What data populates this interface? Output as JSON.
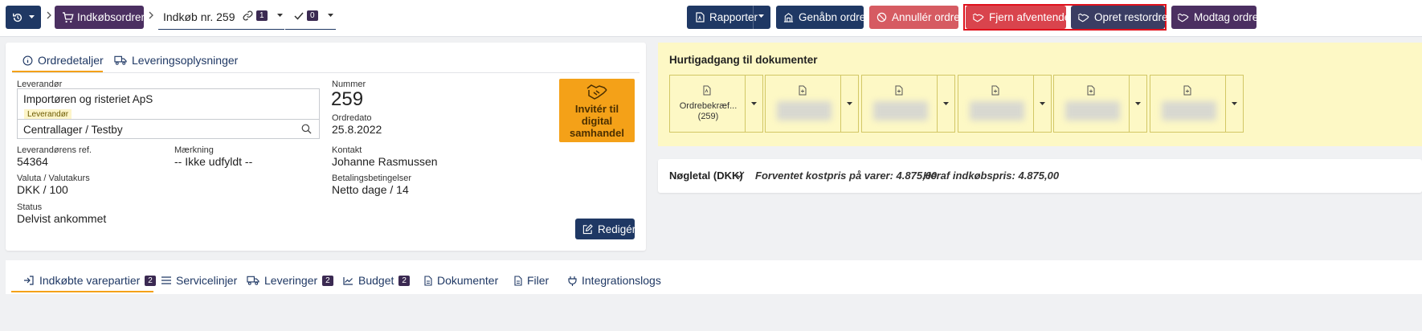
{
  "topbar": {
    "breadcrumb": "Indkøbsordrer",
    "order_title": "Indkøb nr. 259",
    "links_count": "1",
    "checks_count": "0",
    "reports": "Rapporter",
    "reopen": "Genåbn ordre",
    "cancel": "Annullér ordre",
    "remove_pending": "Fjern afventende",
    "create_backorder": "Opret restordre",
    "receive": "Modtag ordre"
  },
  "details": {
    "tab_order": "Ordredetaljer",
    "tab_delivery": "Leveringsoplysninger",
    "supplier_label": "Leverandør",
    "supplier_name": "Importøren og risteriet ApS",
    "supplier_tag": "Leverandør",
    "warehouse": "Centrallager / Testby",
    "supplier_ref_label": "Leverandørens ref.",
    "supplier_ref": "54364",
    "marking_label": "Mærkning",
    "marking": "-- Ikke udfyldt --",
    "currency_label": "Valuta / Valutakurs",
    "currency": "DKK / 100",
    "status_label": "Status",
    "status": "Delvist ankommet",
    "number_label": "Nummer",
    "number": "259",
    "order_date_label": "Ordredato",
    "order_date": "25.8.2022",
    "contact_label": "Kontakt",
    "contact": "Johanne Rasmussen",
    "payment_label": "Betalingsbetingelser",
    "payment": "Netto dage / 14",
    "invite_line1": "Invitér til",
    "invite_line2": "digital",
    "invite_line3": "samhandel",
    "edit": "Redigér"
  },
  "quick": {
    "title": "Hurtigadgang til dokumenter",
    "doc1_line1": "Ordrebekræf...",
    "doc1_line2": "(259)"
  },
  "keyfigures": {
    "title": "Nøgletal (DKK)",
    "expected": "Forventet kostpris på varer: 4.875,00",
    "purchase": "Heraf indkøbspris: 4.875,00"
  },
  "bottom_tabs": {
    "lots": "Indkøbte varepartier",
    "lots_count": "2",
    "service": "Servicelinjer",
    "deliveries": "Leveringer",
    "deliveries_count": "2",
    "budget": "Budget",
    "budget_count": "2",
    "documents": "Dokumenter",
    "files": "Filer",
    "logs": "Integrationslogs"
  },
  "colors": {
    "navy": "#1f3864",
    "plum": "#4b2f61",
    "red": "#d65b62",
    "accent_orange": "#f4a118",
    "quick_bg": "#fdf8c5"
  }
}
